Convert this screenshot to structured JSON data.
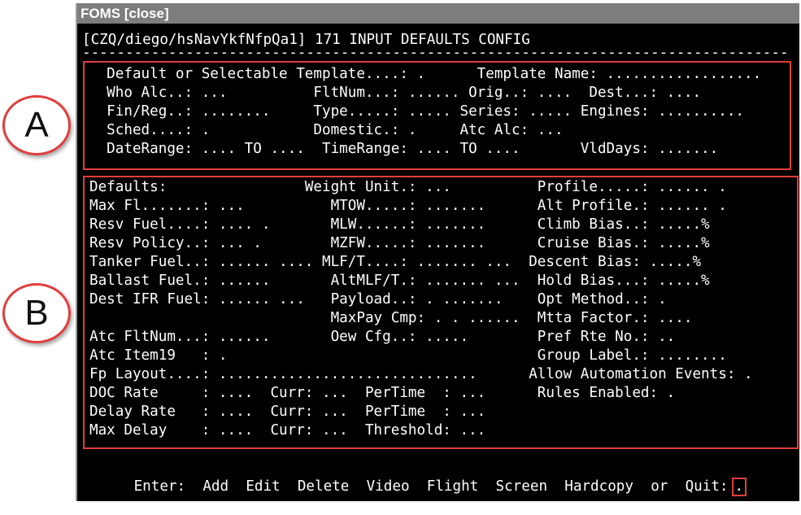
{
  "callouts": {
    "a": "A",
    "b": "B"
  },
  "window": {
    "title": "FOMS [close]"
  },
  "terminal": {
    "header": "[CZQ/diego/hsNavYkfNfpQa1] 171 INPUT DEFAULTS CONFIG",
    "separator": "------------------------------------------------------------------------------------------",
    "section_a_lines": [
      "  Default or Selectable Template....: .      Template Name: ..................",
      "  Who Alc..: ...          FltNum...: ...... Orig..: ....  Dest...: ....",
      "  Fin/Reg..: ........     Type.....: ..... Series: ..... Engines: ..........",
      "  Sched....: .            Domestic.: .     Atc Alc: ...",
      "  DateRange: .... TO ....  TimeRange: .... TO ....       VldDays: ......."
    ],
    "section_b_lines": [
      "Defaults:                Weight Unit.: ...          Profile.....: ...... .",
      "Max Fl.......: ...          MTOW.....: .......      Alt Profile.: ...... .",
      "Resv Fuel....: .... .       MLW......: .......      Climb Bias..: .....%",
      "Resv Policy..: ... .        MZFW.....: .......      Cruise Bias.: .....%",
      "Tanker Fuel..: ...... .... MLF/T....: ....... ...  Descent Bias: .....%",
      "Ballast Fuel.: ......       AltMLF/T.: ....... ...  Hold Bias...: .....%",
      "Dest IFR Fuel: ...... ...   Payload..: . .......    Opt Method..: .",
      "                            MaxPay Cmp: . . ......  Mtta Factor.: ....",
      "Atc FltNum...: ......       Oew Cfg..: .....        Pref Rte No.: ..",
      "Atc Item19   : .                                    Group Label.: ........",
      "Fp Layout....: ..............................      Allow Automation Events: .",
      "DOC Rate     : ....  Curr: ...  PerTime  : ...      Rules Enabled: .",
      "Delay Rate   : ....  Curr: ...  PerTime  : ...",
      "Max Delay    : ....  Curr: ...  Threshold: ..."
    ],
    "command": {
      "prefix": "Enter:",
      "items": [
        "Add",
        "Edit",
        "Delete",
        "Video",
        "Flight",
        "Screen",
        "Hardcopy"
      ],
      "or_text": "or",
      "quit": "Quit:",
      "input_value": "."
    }
  }
}
